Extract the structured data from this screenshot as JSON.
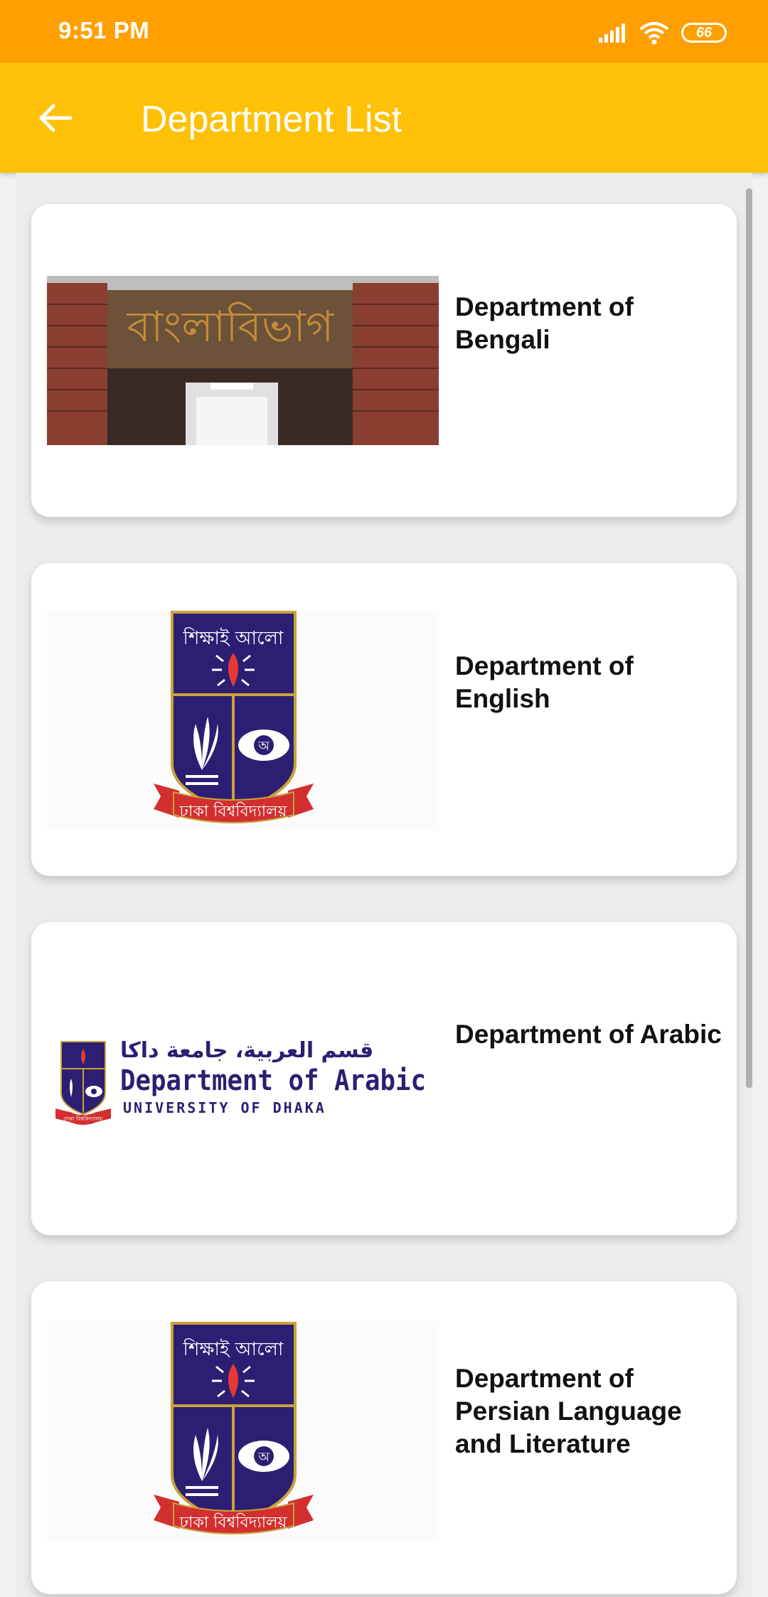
{
  "status_bar": {
    "time": "9:51 PM",
    "battery": "66"
  },
  "app_bar": {
    "title": "Department List",
    "back_icon": "arrow-left-icon"
  },
  "departments": [
    {
      "title": "Department of Bengali",
      "image": "bengali-building-photo",
      "sign": "বাংলাবিভাগ"
    },
    {
      "title": "Department of English",
      "image": "university-crest-logo",
      "crest_motto": "শিক্ষাই আলো",
      "ribbon": "ঢাকা বিশ্ববিদ্যালয়"
    },
    {
      "title": "Department of Arabic",
      "image": "arabic-department-banner",
      "arabic_line": "قسم العربية، جامعة داكا",
      "english_line": "Department of Arabic",
      "university_line": "UNIVERSITY OF DHAKA",
      "ribbon": "ঢাকা বিশ্ববিদ্যালয়"
    },
    {
      "title": "Department of Persian Language and Literature",
      "image": "university-crest-logo",
      "crest_motto": "শিক্ষাই আলো",
      "ribbon": "ঢাকা বিশ্ববিদ্যালয়"
    }
  ],
  "colors": {
    "status_bar": "#ffa000",
    "app_bar": "#ffc107",
    "crest_blue": "#2c1f73",
    "crest_gold": "#c9a23a",
    "ribbon_red": "#d32f2f"
  }
}
